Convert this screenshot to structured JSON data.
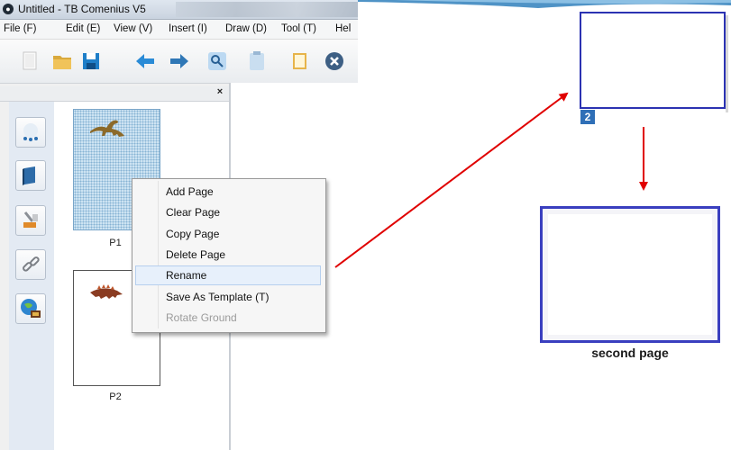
{
  "window": {
    "title": "Untitled - TB Comenius V5",
    "app_icon_glyph": "●"
  },
  "menubar": {
    "items": [
      "File (F)",
      "Edit (E)",
      "View (V)",
      "Insert (I)",
      "Draw (D)",
      "Tool (T)",
      "Hel"
    ]
  },
  "toolbar": {
    "tools": [
      "new-page-icon",
      "open-folder-icon",
      "save-icon",
      "back-arrow-icon",
      "forward-arrow-icon",
      "magnifier-tool-icon",
      "clipboard-icon",
      "note-icon",
      "close-circle-icon"
    ]
  },
  "panel": {
    "close_glyph": "×"
  },
  "sidebar": {
    "buttons": [
      "color-palette-icon",
      "book-icon",
      "tools-icon",
      "link-icon",
      "globe-icon"
    ]
  },
  "pages": [
    {
      "label": "P1",
      "image": "dinosaur-sauropod-icon",
      "selected": true
    },
    {
      "label": "P2",
      "image": "dinosaur-stegosaurus-icon",
      "selected": false
    }
  ],
  "context_menu": {
    "items": [
      {
        "label": "Add Page",
        "highlighted": false,
        "disabled": false
      },
      {
        "label": "Clear Page",
        "highlighted": false,
        "disabled": false
      },
      {
        "label": "Copy Page",
        "highlighted": false,
        "disabled": false
      },
      {
        "label": "Delete Page",
        "highlighted": false,
        "disabled": false
      },
      {
        "label": "Rename",
        "highlighted": true,
        "disabled": false
      },
      {
        "label": "Save As Template (T)",
        "highlighted": false,
        "disabled": false
      },
      {
        "label": "Rotate Ground",
        "highlighted": false,
        "disabled": true
      }
    ]
  },
  "illustration": {
    "rename_value": "2",
    "caption": "second page",
    "accent_color": "#2b32b2",
    "arrow_color": "#e00000"
  }
}
